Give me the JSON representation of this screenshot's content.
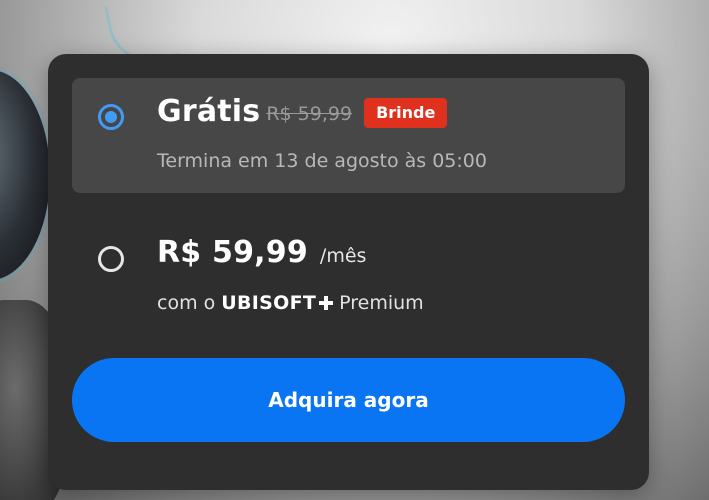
{
  "offer": {
    "selected": {
      "price": "Grátis",
      "original_price": "R$ 59,99",
      "badge": "Brinde",
      "ends_text": "Termina em 13 de agosto às 05:00"
    },
    "subscription": {
      "price": "R$ 59,99",
      "period": "/mês",
      "with_prefix": "com o",
      "brand": "UBISOFT",
      "brand_plus_icon": "plus-icon",
      "tier": "Premium"
    },
    "cta_label": "Adquira agora"
  },
  "colors": {
    "card": "#2e2e2e",
    "selected_option": "#474747",
    "radio_selected": "#3f9bf5",
    "badge": "#e0301e",
    "cta": "#0a75f2"
  }
}
